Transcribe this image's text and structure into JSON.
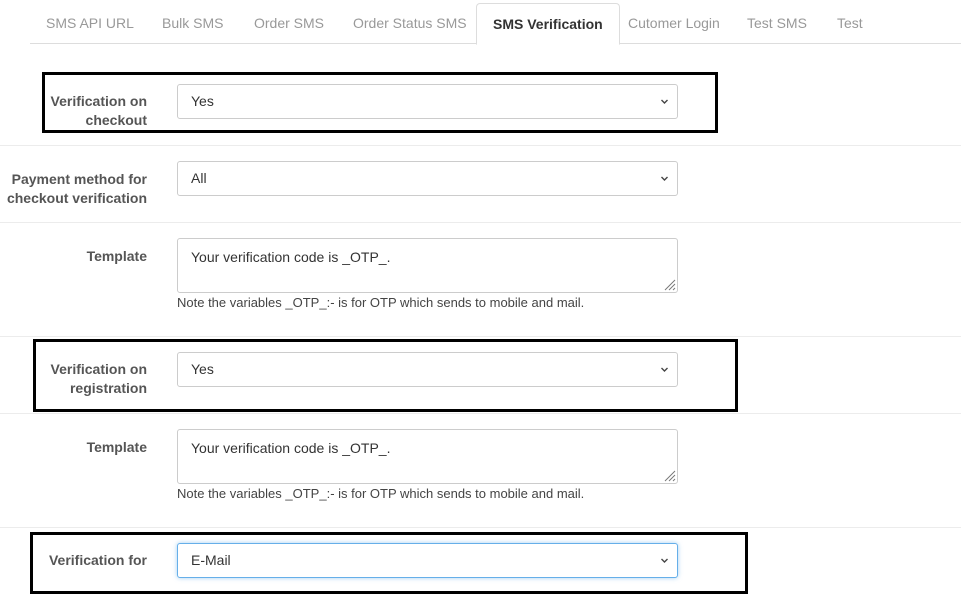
{
  "tabs": [
    {
      "label": "SMS API URL",
      "active": false
    },
    {
      "label": "Bulk SMS",
      "active": false
    },
    {
      "label": "Order SMS",
      "active": false
    },
    {
      "label": "Order Status SMS",
      "active": false
    },
    {
      "label": "SMS Verification",
      "active": true
    },
    {
      "label": "Cutomer Login",
      "active": false
    },
    {
      "label": "Test SMS",
      "active": false
    },
    {
      "label": "Test",
      "active": false
    }
  ],
  "form": {
    "checkout_verification": {
      "label_line1": "Verification on",
      "label_line2": "checkout",
      "value": "Yes"
    },
    "payment_method": {
      "label_line1": "Payment method for",
      "label_line2": "checkout verification",
      "value": "All"
    },
    "checkout_template": {
      "label": "Template",
      "value": "Your verification code is _OTP_.",
      "help": "Note the variables _OTP_:- is for OTP which sends to mobile and mail."
    },
    "registration_verification": {
      "label_line1": "Verification on",
      "label_line2": "registration",
      "value": "Yes"
    },
    "registration_template": {
      "label": "Template",
      "value": "Your verification code is _OTP_.",
      "help": "Note the variables _OTP_:- is for OTP which sends to mobile and mail."
    },
    "verification_for": {
      "label": "Verification for",
      "value": "E-Mail"
    }
  },
  "colors": {
    "focus_border": "#66afe9",
    "highlight_box": "#000000",
    "muted_tab": "#999999"
  }
}
